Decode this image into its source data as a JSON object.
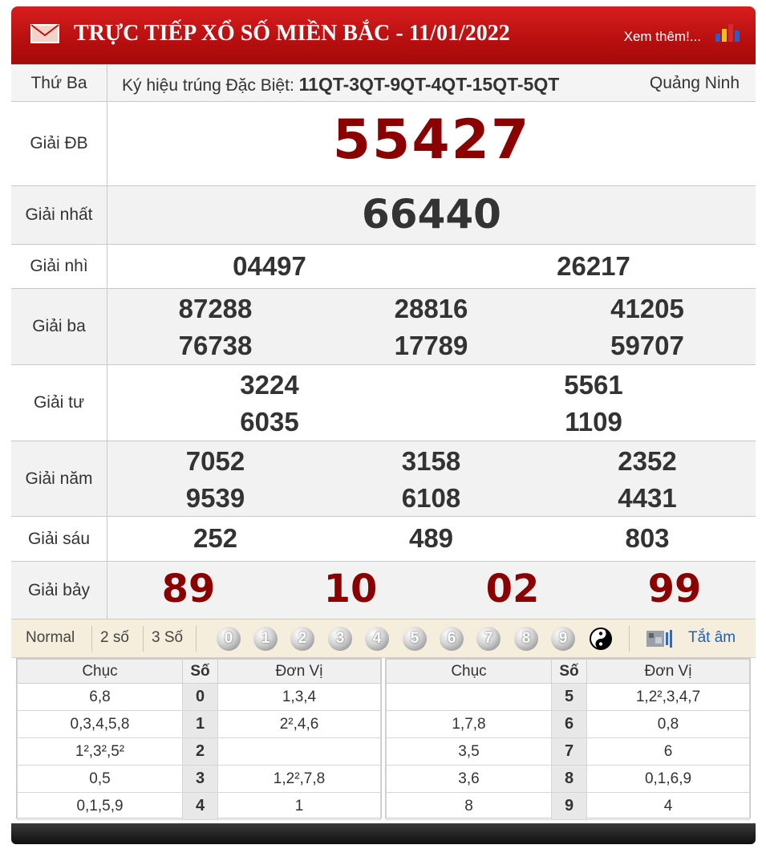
{
  "header": {
    "title": "TRỰC TIẾP XỔ SỐ MIỀN BẮC - 11/01/2022",
    "more_label": "Xem thêm!..."
  },
  "info": {
    "weekday": "Thứ Ba",
    "symbol_label": "Ký hiệu trúng Đặc Biệt:",
    "symbol_value": "11QT-3QT-9QT-4QT-15QT-5QT",
    "province": "Quảng Ninh"
  },
  "prizes": {
    "db": {
      "label": "Giải ĐB",
      "numbers": [
        "55427"
      ]
    },
    "g1": {
      "label": "Giải nhất",
      "numbers": [
        "66440"
      ]
    },
    "g2": {
      "label": "Giải nhì",
      "numbers": [
        "04497",
        "26217"
      ]
    },
    "g3": {
      "label": "Giải ba",
      "numbers": [
        "87288",
        "28816",
        "41205",
        "76738",
        "17789",
        "59707"
      ]
    },
    "g4": {
      "label": "Giải tư",
      "numbers": [
        "3224",
        "5561",
        "6035",
        "1109"
      ]
    },
    "g5": {
      "label": "Giải năm",
      "numbers": [
        "7052",
        "3158",
        "2352",
        "9539",
        "6108",
        "4431"
      ]
    },
    "g6": {
      "label": "Giải sáu",
      "numbers": [
        "252",
        "489",
        "803"
      ]
    },
    "g7": {
      "label": "Giải bảy",
      "numbers": [
        "89",
        "10",
        "02",
        "99"
      ]
    }
  },
  "toolbar": {
    "modes": [
      "Normal",
      "2 số",
      "3 Số"
    ],
    "digits": [
      "0",
      "1",
      "2",
      "3",
      "4",
      "5",
      "6",
      "7",
      "8",
      "9"
    ],
    "mute_label": "Tắt âm"
  },
  "loto": {
    "headers": {
      "chuc": "Chục",
      "so": "Số",
      "donvi": "Đơn Vị"
    },
    "left": [
      {
        "chuc": "6,8",
        "so": "0",
        "donvi": "1,3,4"
      },
      {
        "chuc": "0,3,4,5,8",
        "so": "1",
        "donvi": "2²,4,6"
      },
      {
        "chuc": "1²,3²,5²",
        "so": "2",
        "donvi": ""
      },
      {
        "chuc": "0,5",
        "so": "3",
        "donvi": "1,2²,7,8"
      },
      {
        "chuc": "0,1,5,9",
        "so": "4",
        "donvi": "1"
      }
    ],
    "right": [
      {
        "chuc": "",
        "so": "5",
        "donvi": "1,2²,3,4,7"
      },
      {
        "chuc": "1,7,8",
        "so": "6",
        "donvi": "0,8"
      },
      {
        "chuc": "3,5",
        "so": "7",
        "donvi": "6"
      },
      {
        "chuc": "3,6",
        "so": "8",
        "donvi": "0,1,6,9"
      },
      {
        "chuc": "8",
        "so": "9",
        "donvi": "4"
      }
    ]
  }
}
